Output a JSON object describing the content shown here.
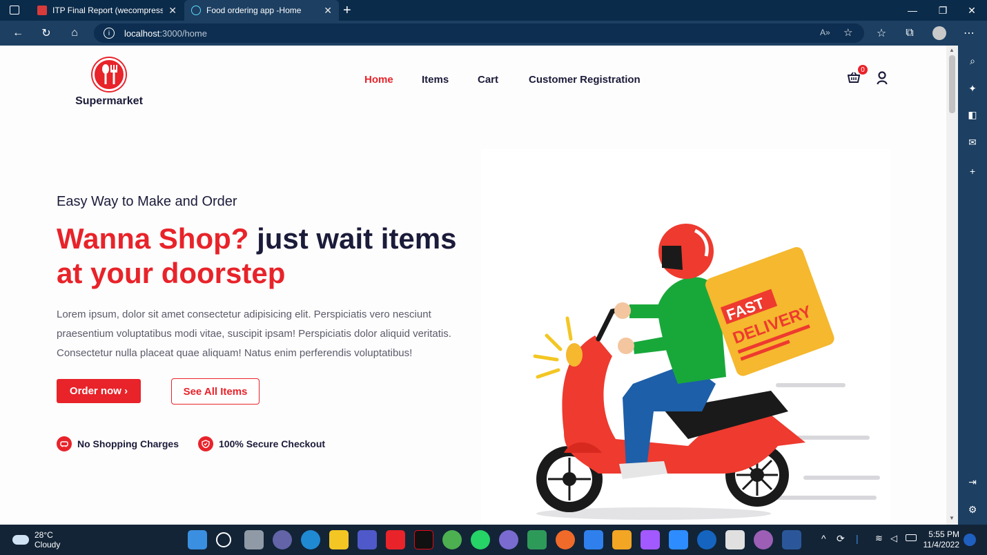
{
  "browser": {
    "tabs": [
      {
        "title": "ITP Final Report (wecompress.co",
        "active": false
      },
      {
        "title": "Food ordering app -Home",
        "active": true
      }
    ],
    "url_host": "localhost",
    "url_path": ":3000/home"
  },
  "site": {
    "brand": "Supermarket",
    "nav": [
      {
        "label": "Home",
        "active": true
      },
      {
        "label": "Items",
        "active": false
      },
      {
        "label": "Cart",
        "active": false
      },
      {
        "label": "Customer Registration",
        "active": false
      }
    ],
    "cart_count": "0"
  },
  "hero": {
    "tagline": "Easy Way to Make and Order",
    "headline_red": "Wanna Shop?",
    "headline_dark": " just wait items",
    "headline_red2": "at your doorstep",
    "description": "Lorem ipsum, dolor sit amet consectetur adipisicing elit. Perspiciatis vero nesciunt praesentium voluptatibus modi vitae, suscipit ipsam! Perspiciatis dolor aliquid veritatis. Consectetur nulla placeat quae aliquam! Natus enim perferendis voluptatibus!",
    "order_button": "Order now ›",
    "see_all_button": "See All Items",
    "features": [
      "No Shopping Charges",
      "100% Secure Checkout"
    ],
    "illustration_text": [
      "FAST",
      "DELIVERY"
    ]
  },
  "taskbar": {
    "temperature": "28°C",
    "weather": "Cloudy",
    "time": "5:55 PM",
    "date": "11/4/2022"
  },
  "colors": {
    "accent": "#e8232a",
    "dark_text": "#1b1b3a",
    "browser_chrome": "#1c3f62"
  }
}
